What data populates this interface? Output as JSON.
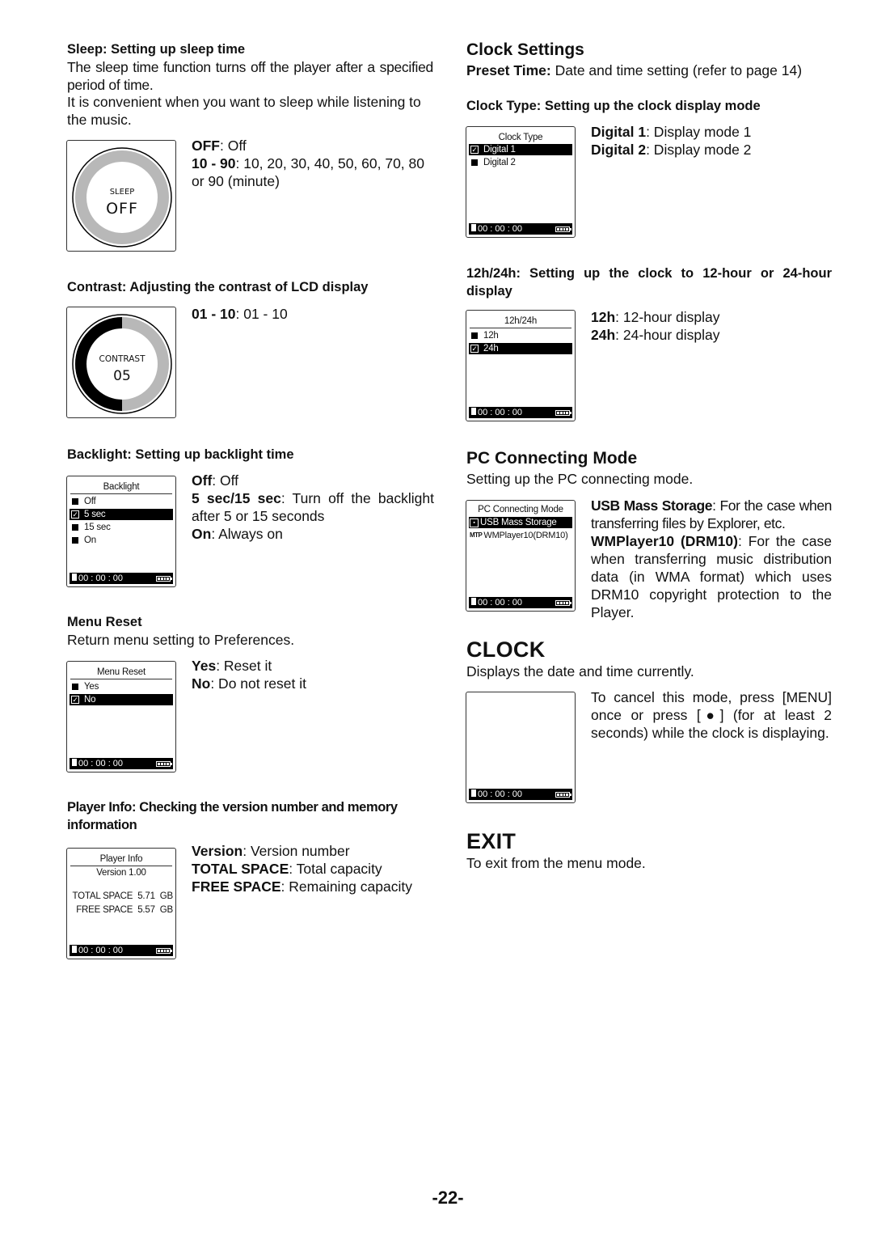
{
  "left": {
    "sleep": {
      "heading": "Sleep: Setting up sleep time",
      "para1": "The sleep time function turns off the player after a specified period of time.",
      "para2": "It is convenient when you want to sleep while listening to the music.",
      "dial_label": "SLEEP",
      "dial_value": "OFF",
      "opt1_key": "OFF",
      "opt1_val": ": Off",
      "opt2_key": "10 - 90",
      "opt2_val": ": 10, 20, 30, 40, 50, 60, 70, 80 or 90 (minute)"
    },
    "contrast": {
      "heading": "Contrast: Adjusting the contrast of LCD display",
      "dial_label": "CONTRAST",
      "dial_value": "05",
      "level_fraction": 0.5,
      "opt1_key": "01 - 10",
      "opt1_val": ": 01 - 10"
    },
    "backlight": {
      "heading": "Backlight: Setting up backlight time",
      "screen": {
        "title": "Backlight",
        "items": [
          {
            "label": "Off",
            "selected": false
          },
          {
            "label": "5 sec",
            "selected": true
          },
          {
            "label": "15 sec",
            "selected": false
          },
          {
            "label": "On",
            "selected": false
          }
        ],
        "time": "00 : 00 : 00"
      },
      "opt1_key": "Off",
      "opt1_val": ": Off",
      "opt2_key": "5 sec/15 sec",
      "opt2_val": ": Turn off the backlight after 5 or 15 seconds",
      "opt3_key": "On",
      "opt3_val": ": Always on"
    },
    "menu_reset": {
      "heading": "Menu Reset",
      "para": "Return menu setting to Preferences.",
      "screen": {
        "title": "Menu Reset",
        "items": [
          {
            "label": "Yes",
            "selected": false
          },
          {
            "label": "No",
            "selected": true
          }
        ],
        "time": "00 : 00 : 00"
      },
      "opt1_key": "Yes",
      "opt1_val": ": Reset it",
      "opt2_key": "No",
      "opt2_val": ": Do not reset it"
    },
    "player_info": {
      "heading": "Player Info: Checking the version number and memory information",
      "screen": {
        "title": "Player Info",
        "version": "Version 1.00",
        "total": "TOTAL SPACE  5.71  GB",
        "free": "FREE SPACE  5.57  GB",
        "time": "00 : 00 : 00"
      },
      "opt1_key": "Version",
      "opt1_val": ": Version number",
      "opt2_key": "TOTAL SPACE",
      "opt2_val": ": Total capacity",
      "opt3_key": "FREE SPACE",
      "opt3_val": ": Remaining capacity"
    }
  },
  "right": {
    "clock_settings": {
      "heading": "Clock Settings",
      "preset_key": "Preset Time:",
      "preset_val": " Date and time setting (refer to page 14)",
      "clock_type_heading": "Clock Type: Setting up the clock display mode",
      "clock_type_screen": {
        "title": "Clock Type",
        "items": [
          {
            "label": "Digital 1",
            "selected": true
          },
          {
            "label": "Digital 2",
            "selected": false
          }
        ],
        "time": "00 : 00 : 00"
      },
      "ct_opt1_key": "Digital 1",
      "ct_opt1_val": ": Display mode 1",
      "ct_opt2_key": "Digital 2",
      "ct_opt2_val": ": Display mode 2",
      "hour_heading": "12h/24h: Setting up the clock to 12-hour or 24-hour display",
      "hour_screen": {
        "title": "12h/24h",
        "items": [
          {
            "label": "12h",
            "selected": false
          },
          {
            "label": "24h",
            "selected": true
          }
        ],
        "time": "00 : 00 : 00"
      },
      "h_opt1_key": "12h",
      "h_opt1_val": ": 12-hour display",
      "h_opt2_key": "24h",
      "h_opt2_val": ": 24-hour display"
    },
    "pc_mode": {
      "heading": "PC Connecting Mode",
      "para": "Setting up the PC connecting mode.",
      "screen": {
        "title": "PC Connecting Mode",
        "items": [
          {
            "label": "USB Mass Storage",
            "selected": true,
            "icon": "usb-storage-icon"
          },
          {
            "label": "WMPlayer10(DRM10)",
            "selected": false,
            "icon": "mtp-icon"
          }
        ],
        "time": "00 : 00 : 00"
      },
      "opt1_key": "USB Mass Storage",
      "opt1_val": ": For the case when transferring files by Explorer, etc.",
      "opt2_key": "WMPlayer10 (DRM10)",
      "opt2_val": ": For the case when transferring music distribution data (in WMA format) which uses DRM10 copyright protection to the Player."
    },
    "clock": {
      "heading": "CLOCK",
      "para": "Displays the date and time currently.",
      "screen": {
        "time": "00 : 00 : 00"
      },
      "cancel_a": "To cancel this mode, press [MENU] once or press [",
      "cancel_icon": "●",
      "cancel_b": "] (for at least 2 seconds) while the clock is displaying."
    },
    "exit": {
      "heading": "EXIT",
      "para": "To exit from the menu mode."
    }
  },
  "page_number": "-22-"
}
